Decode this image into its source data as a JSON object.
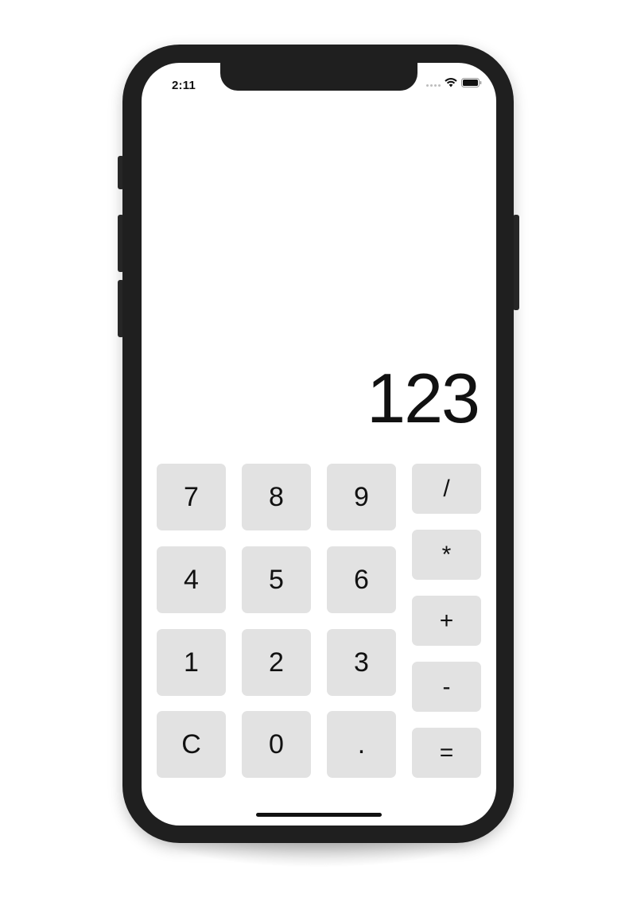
{
  "status_bar": {
    "time": "2:11"
  },
  "display": {
    "value": "123"
  },
  "keypad": {
    "digits": [
      [
        "7",
        "8",
        "9"
      ],
      [
        "4",
        "5",
        "6"
      ],
      [
        "1",
        "2",
        "3"
      ],
      [
        "C",
        "0",
        "."
      ]
    ],
    "operators": [
      "/",
      "*",
      "+",
      "-",
      "="
    ]
  },
  "colors": {
    "key_background": "#e2e2e2",
    "screen_background": "#ffffff",
    "phone_bezel": "#1f1f1f",
    "text": "#111111"
  }
}
